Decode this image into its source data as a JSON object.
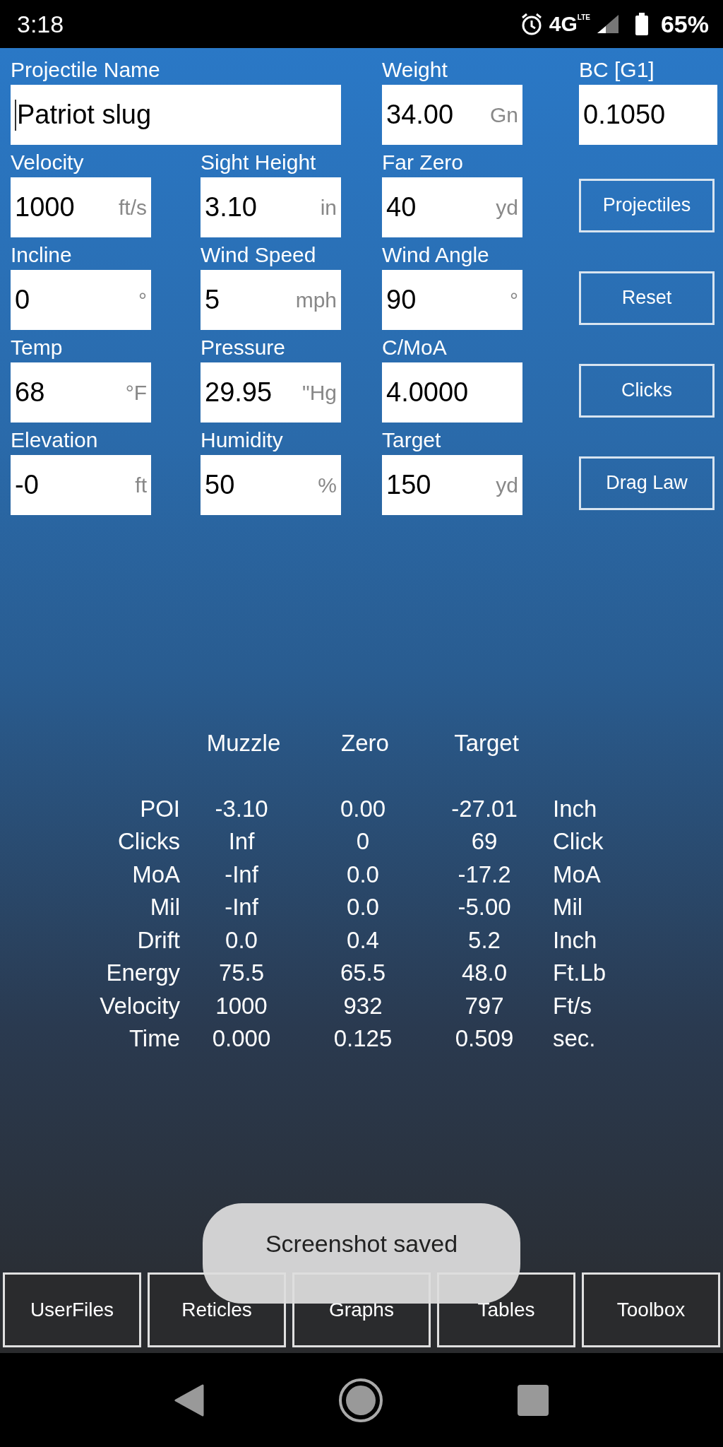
{
  "status_bar": {
    "time": "3:18",
    "network": "4G",
    "network_sub": "LTE",
    "battery": "65%"
  },
  "top_row": [
    {
      "label": "Projectile Name",
      "value": "Patriot slug",
      "focused": true
    },
    {
      "label": "Weight",
      "value": "34.00",
      "unit": "Gn"
    },
    {
      "label": "BC [G1]",
      "value": "0.1050"
    }
  ],
  "rows": [
    {
      "fields": [
        {
          "label": "Velocity",
          "value": "1000",
          "unit": "ft/s"
        },
        {
          "label": "Sight Height",
          "value": "3.10",
          "unit": "in"
        },
        {
          "label": "Far Zero",
          "value": "40",
          "unit": "yd"
        }
      ],
      "button": "Projectiles"
    },
    {
      "fields": [
        {
          "label": "Incline",
          "value": "0",
          "unit": "°"
        },
        {
          "label": "Wind Speed",
          "value": "5",
          "unit": "mph"
        },
        {
          "label": "Wind Angle",
          "value": "90",
          "unit": "°"
        }
      ],
      "button": "Reset"
    },
    {
      "fields": [
        {
          "label": "Temp",
          "value": "68",
          "unit": "°F"
        },
        {
          "label": "Pressure",
          "value": "29.95",
          "unit": "\"Hg"
        },
        {
          "label": "C/MoA",
          "value": "4.0000"
        }
      ],
      "button": "Clicks"
    },
    {
      "fields": [
        {
          "label": "Elevation",
          "value": "-0",
          "unit": "ft"
        },
        {
          "label": "Humidity",
          "value": "50",
          "unit": "%"
        },
        {
          "label": "Target",
          "value": "150",
          "unit": "yd"
        }
      ],
      "button": "Drag Law"
    }
  ],
  "results": {
    "columns": [
      "Muzzle",
      "Zero",
      "Target"
    ],
    "rows": [
      {
        "label": "POI",
        "values": [
          "-3.10",
          "0.00",
          "-27.01"
        ],
        "unit": "Inch"
      },
      {
        "label": "Clicks",
        "values": [
          "Inf",
          "0",
          "69"
        ],
        "unit": "Click"
      },
      {
        "label": "MoA",
        "values": [
          "-Inf",
          "0.0",
          "-17.2"
        ],
        "unit": "MoA"
      },
      {
        "label": "Mil",
        "values": [
          "-Inf",
          "0.0",
          "-5.00"
        ],
        "unit": "Mil"
      },
      {
        "label": "Drift",
        "values": [
          "0.0",
          "0.4",
          "5.2"
        ],
        "unit": "Inch"
      },
      {
        "label": "Energy",
        "values": [
          "75.5",
          "65.5",
          "48.0"
        ],
        "unit": "Ft.Lb"
      },
      {
        "label": "Velocity",
        "values": [
          "1000",
          "932",
          "797"
        ],
        "unit": "Ft/s"
      },
      {
        "label": "Time",
        "values": [
          "0.000",
          "0.125",
          "0.509"
        ],
        "unit": "sec."
      }
    ]
  },
  "bottom_buttons": [
    "UserFiles",
    "Reticles",
    "Graphs",
    "Tables",
    "Toolbox"
  ],
  "toast": "Screenshot saved"
}
